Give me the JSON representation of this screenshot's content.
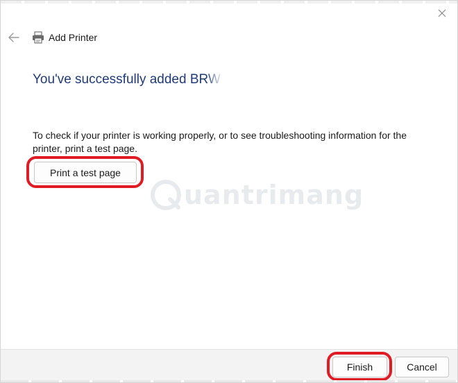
{
  "window": {
    "title": "Add Printer",
    "close_icon": "close-icon",
    "back_icon": "back-arrow-icon",
    "printer_icon": "printer-icon"
  },
  "main": {
    "heading": "You've successfully added BRWFC",
    "description": "To check if your printer is working properly, or to see troubleshooting information for the printer, print a test page.",
    "print_test_label": "Print a test page"
  },
  "watermark": {
    "text": "uantrimang"
  },
  "footer": {
    "finish_label": "Finish",
    "cancel_label": "Cancel"
  },
  "colors": {
    "heading": "#1f3b7a",
    "highlight": "#e01b24",
    "footer_bg": "#f3f3f3"
  }
}
